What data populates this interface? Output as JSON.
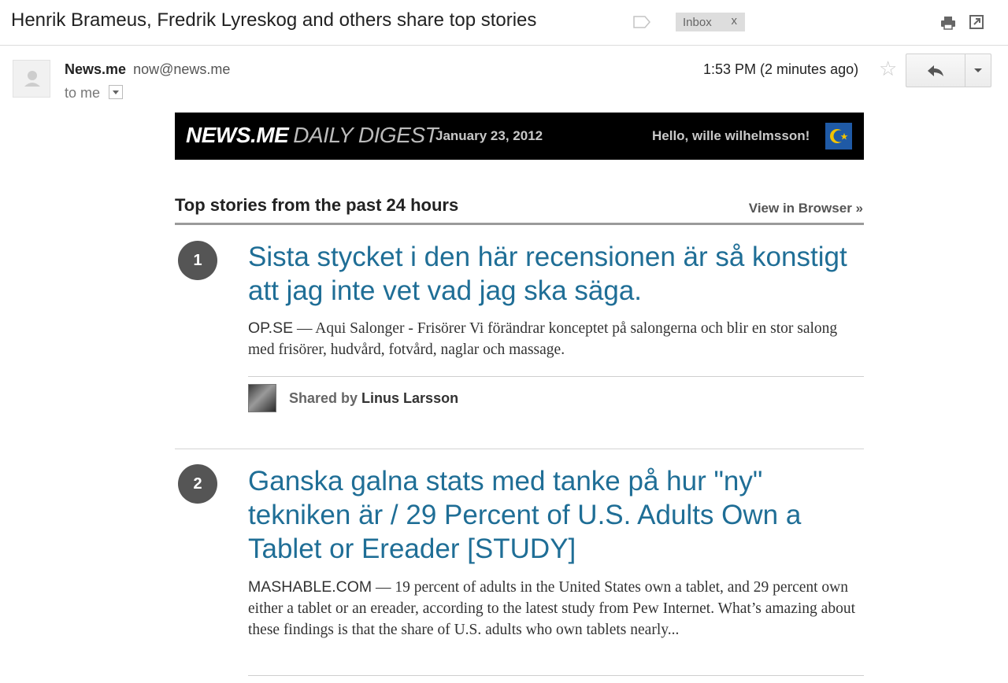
{
  "subject": {
    "title": "Henrik Brameus, Fredrik Lyreskog and others share top stories",
    "label_chip": "Inbox",
    "label_chip_remove": "x"
  },
  "header": {
    "sender_name": "News.me",
    "sender_email": "now@news.me",
    "recipient": "to me",
    "timestamp": "1:53 PM (2 minutes ago)"
  },
  "banner": {
    "brand_bold": "NEWS.ME",
    "brand_light": "DAILY DIGEST",
    "date": "January 23, 2012",
    "greeting": "Hello, wille wilhelmsson!"
  },
  "section": {
    "title": "Top stories from the past 24 hours",
    "view_in_browser": "View in Browser »"
  },
  "stories": [
    {
      "number": "1",
      "headline": "Sista stycket i den här recensionen är så konstigt att jag inte vet vad jag ska säga.",
      "source": "OP.SE",
      "summary": " — Aqui Salonger  -  Frisörer Vi förändrar konceptet på salongerna och blir en stor salong med frisörer, hudvård, fotvård, naglar och massage.",
      "shared_prefix": "Shared by",
      "shared_by": "Linus Larsson"
    },
    {
      "number": "2",
      "headline": "Ganska galna stats med tanke på hur \"ny\" tekniken är / 29 Percent of U.S. Adults Own a Tablet or Ereader [STUDY]",
      "source": "MASHABLE.COM",
      "summary": " — 19 percent of adults in the United States own a tablet, and 29 percent own either a tablet or an ereader, according to the latest study from Pew Internet. What’s amazing about these findings is that the share of U.S. adults who own tablets nearly..."
    }
  ],
  "colors": {
    "headline_link": "#1f6e96",
    "banner_background": "#000000",
    "number_badge": "#555555",
    "flag_blue": "#1f5aa6",
    "flag_crescent": "#f2c200"
  },
  "icons": {
    "label": "label-tag-icon",
    "print": "print-icon",
    "popout": "new-window-icon",
    "star": "star-icon",
    "reply": "reply-arrow-icon",
    "more": "chevron-down-icon",
    "flag": "flag-icon"
  }
}
